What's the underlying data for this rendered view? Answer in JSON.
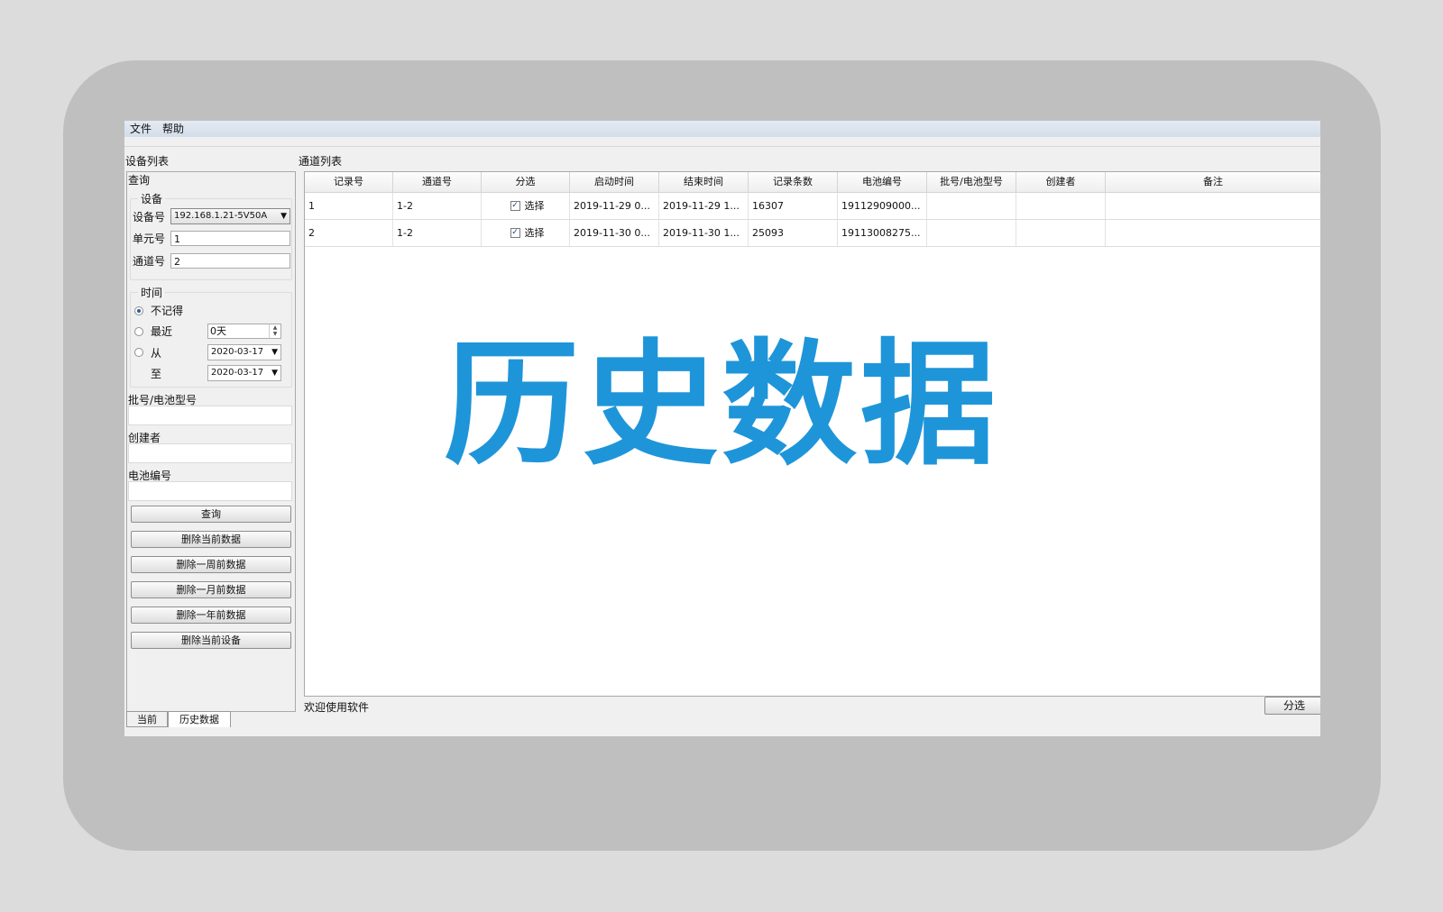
{
  "overlay": {
    "title": "历史数据"
  },
  "menu": {
    "items": [
      "文件",
      "帮助"
    ]
  },
  "device_list": {
    "label": "设备列表",
    "panel_title": "查询",
    "device_group": {
      "legend": "设备",
      "device_label": "设备号",
      "device_value": "192.168.1.21-5V50A",
      "unit_label": "单元号",
      "unit_value": "1",
      "channel_label": "通道号",
      "channel_value": "2"
    },
    "time_group": {
      "legend": "时间",
      "opt_none": "不记得",
      "opt_recent": "最近",
      "recent_value": "0天",
      "opt_from": "从",
      "from_value": "2020-03-17",
      "to_label": "至",
      "to_value": "2020-03-17",
      "selected": "opt_none"
    },
    "batch_label": "批号/电池型号",
    "batch_value": "",
    "creator_label": "创建者",
    "creator_value": "",
    "battery_label": "电池编号",
    "battery_value": "",
    "buttons": {
      "query": "查询",
      "delete_current": "删除当前数据",
      "delete_week": "删除一周前数据",
      "delete_month": "删除一月前数据",
      "delete_year": "删除一年前数据",
      "delete_device": "删除当前设备"
    }
  },
  "tabs": {
    "current": "当前",
    "history": "历史数据"
  },
  "channel_list": {
    "label": "通道列表",
    "columns": [
      "记录号",
      "通道号",
      "分选",
      "启动时间",
      "结束时间",
      "记录条数",
      "电池编号",
      "批号/电池型号",
      "创建者",
      "备注"
    ],
    "rows": [
      {
        "record": "1",
        "channel": "1-2",
        "select": "选择",
        "start": "2019-11-29 0...",
        "end": "2019-11-29 1...",
        "count": "16307",
        "battery": "19112909000...",
        "batch": "",
        "creator": "",
        "note": ""
      },
      {
        "record": "2",
        "channel": "1-2",
        "select": "选择",
        "start": "2019-11-30 0...",
        "end": "2019-11-30 1...",
        "count": "25093",
        "battery": "19113008275...",
        "batch": "",
        "creator": "",
        "note": ""
      }
    ]
  },
  "status": {
    "text": "欢迎使用软件"
  },
  "split_button": "分选",
  "colors": {
    "overlay_title": "#1e95d9",
    "frame": "#bfbfbf",
    "background": "#dcdcdc"
  }
}
